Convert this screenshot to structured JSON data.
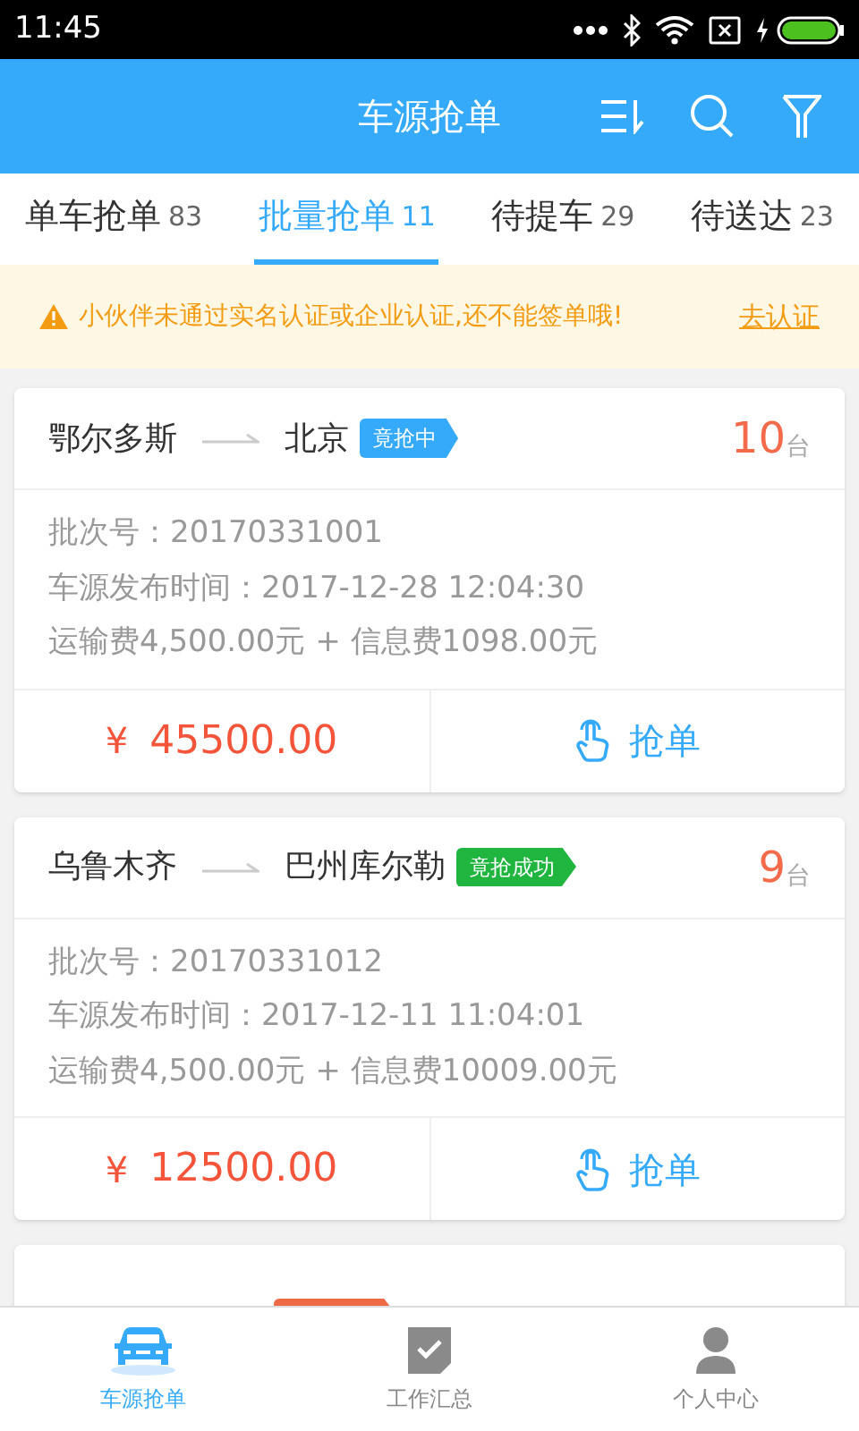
{
  "status_bar": {
    "time": "11:45"
  },
  "header": {
    "title": "车源抢单"
  },
  "tabs": [
    {
      "label": "单车抢单",
      "count": "83",
      "selected": false
    },
    {
      "label": "批量抢单",
      "count": "11",
      "selected": true
    },
    {
      "label": "待提车",
      "count": "29",
      "selected": false
    },
    {
      "label": "待送达",
      "count": "23",
      "selected": false
    }
  ],
  "notice": {
    "text": "小伙伴未通过实名认证或企业认证,还不能签单哦!",
    "link": "去认证"
  },
  "orders": [
    {
      "from": "鄂尔多斯",
      "to": "北京",
      "status": "竟抢中",
      "color": "#35aafa",
      "quantity": "10",
      "unit": "台",
      "batch": "批次号：20170331001",
      "published": "车源发布时间：2017-12-28 12:04:30",
      "fees": "运输费4,500.00元 + 信息费1098.00元",
      "price_symbol": "¥",
      "price": "45500.00",
      "action": "抢单"
    },
    {
      "from": "乌鲁木齐",
      "to": "巴州库尔勒",
      "status": "竟抢成功",
      "color": "#1fb53f",
      "quantity": "9",
      "unit": "台",
      "batch": "批次号：20170331012",
      "published": "车源发布时间：2017-12-11 11:04:01",
      "fees": "运输费4,500.00元 + 信息费10009.00元",
      "price_symbol": "¥",
      "price": "12500.00",
      "action": "抢单"
    },
    {
      "color": "#ee6a45"
    }
  ],
  "bottom_nav": [
    {
      "label": "车源抢单",
      "kind": "car",
      "selected": true
    },
    {
      "label": "工作汇总",
      "kind": "check",
      "selected": false
    },
    {
      "label": "个人中心",
      "kind": "person",
      "selected": false
    }
  ]
}
